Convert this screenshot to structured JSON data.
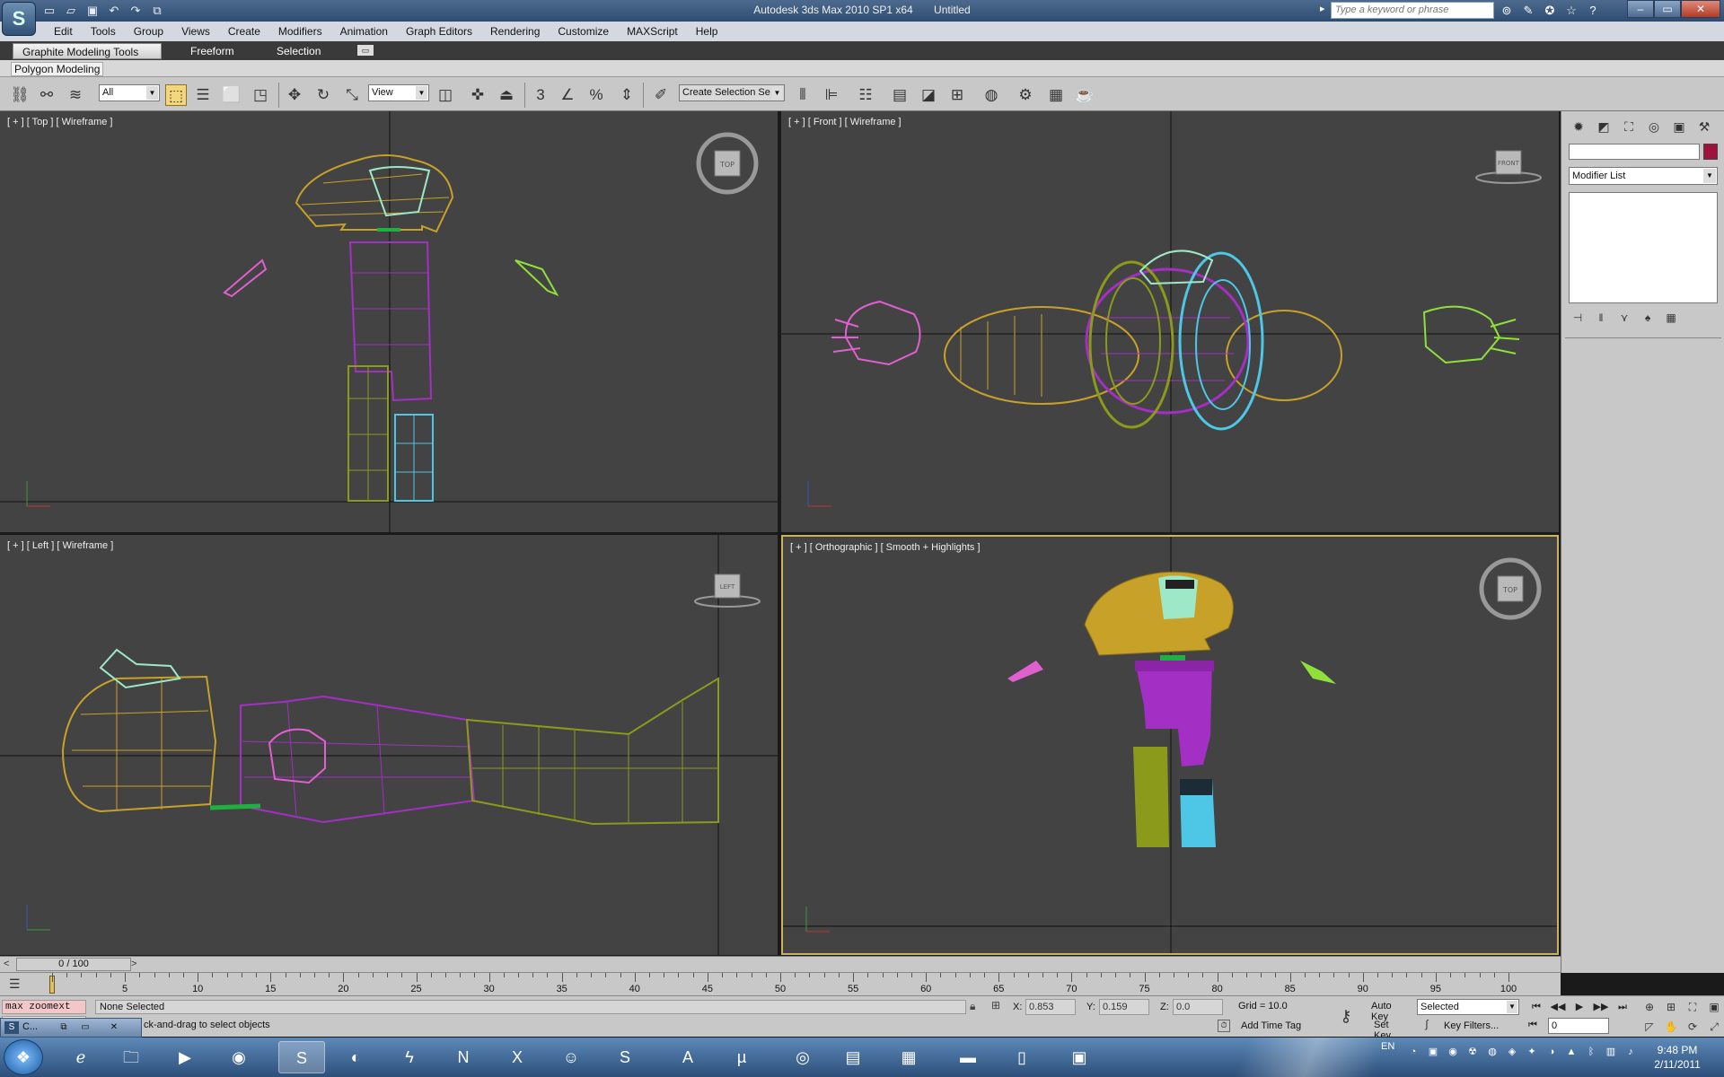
{
  "window": {
    "app_title": "Autodesk 3ds Max  2010 SP1 x64",
    "doc_title": "Untitled",
    "search_placeholder": "Type a keyword or phrase",
    "logo": "S"
  },
  "menu": [
    "Edit",
    "Tools",
    "Group",
    "Views",
    "Create",
    "Modifiers",
    "Animation",
    "Graph Editors",
    "Rendering",
    "Customize",
    "MAXScript",
    "Help"
  ],
  "ribbon": {
    "tabs": [
      "Graphite Modeling Tools",
      "Freeform",
      "Selection"
    ],
    "panel_label": "Polygon Modeling"
  },
  "toolbar": {
    "selection_filter": "All",
    "ref_coord": "View",
    "named_selection": "Create Selection Se"
  },
  "viewports": {
    "top": {
      "label": "[ + ] [ Top ] [ Wireframe ]",
      "cube": "TOP"
    },
    "front": {
      "label": "[ + ] [ Front ] [ Wireframe ]",
      "cube": "FRONT"
    },
    "left": {
      "label": "[ + ] [ Left ] [ Wireframe ]",
      "cube": "LEFT"
    },
    "ortho": {
      "label": "[ + ] [ Orthographic ] [ Smooth + Highlights ]",
      "cube": "TOP"
    }
  },
  "command_panel": {
    "modifier_list": "Modifier List",
    "object_color": "#a0113e"
  },
  "time_slider": {
    "position": "0 / 100",
    "left_arrow": "<",
    "right_arrow": ">"
  },
  "trackbar": {
    "tick_labels": [
      "0",
      "5",
      "10",
      "15",
      "20",
      "25",
      "30",
      "35",
      "40",
      "45",
      "50",
      "55",
      "60",
      "65",
      "70",
      "75",
      "80",
      "85",
      "90",
      "95",
      "100"
    ]
  },
  "status": {
    "maxscript": "max zoomext",
    "selection": "None Selected",
    "prompt": "ck-and-drag to select objects",
    "x_label": "X:",
    "x_value": "0.853",
    "y_label": "Y:",
    "y_value": "0.159",
    "z_label": "Z:",
    "z_value": "0.0",
    "grid": "Grid = 10.0",
    "add_time_tag": "Add Time Tag",
    "auto_key": "Auto Key",
    "set_key": "Set Key",
    "key_mode": "Selected",
    "key_filters": "Key Filters...",
    "frame": "0"
  },
  "mini_window": {
    "label": "C..."
  },
  "taskbar": {
    "lang": "EN",
    "time": "9:48 PM",
    "date": "2/11/2011"
  },
  "colors": {
    "torso": "#c8a128",
    "collar": "#9ee8c8",
    "pants": "#a32fc4",
    "left_boot": "#8c9a1c",
    "right_boot": "#4ec7e6",
    "left_hand": "#e060d0",
    "right_hand": "#8fe03a",
    "belt": "#20b040"
  }
}
